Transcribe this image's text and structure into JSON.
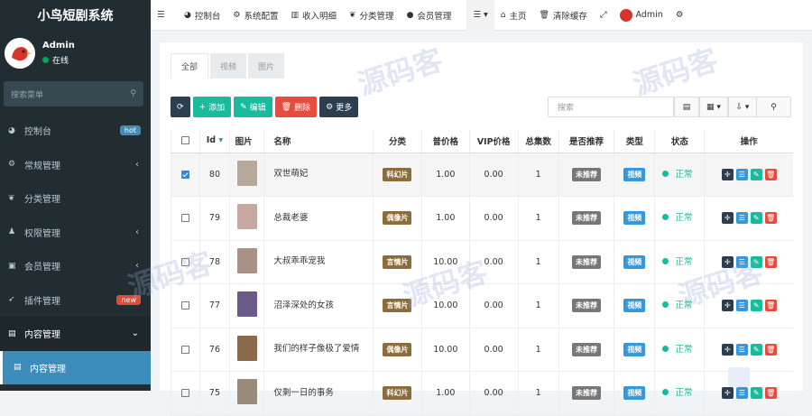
{
  "app": {
    "title": "小鸟短剧系统"
  },
  "user": {
    "name": "Admin",
    "status": "在线"
  },
  "sidebar": {
    "search_placeholder": "搜索菜单",
    "items": [
      {
        "label": "控制台",
        "badge": "hot",
        "badge_color": "#3c8dbc"
      },
      {
        "label": "常规管理",
        "arrow": "‹"
      },
      {
        "label": "分类管理"
      },
      {
        "label": "权限管理",
        "arrow": "‹"
      },
      {
        "label": "会员管理",
        "arrow": "‹"
      },
      {
        "label": "插件管理",
        "badge": "new",
        "badge_color": "#dd4b39"
      },
      {
        "label": "内容管理",
        "arrow": "⌄"
      },
      {
        "label": "内容管理"
      }
    ]
  },
  "topbar": {
    "items": [
      "控制台",
      "系统配置",
      "收入明细",
      "分类管理",
      "会员管理"
    ],
    "home": "主页",
    "clear_cache": "清除缓存",
    "admin": "Admin"
  },
  "tabs": [
    "全部",
    "视频",
    "图片"
  ],
  "toolbar": {
    "add": "添加",
    "edit": "编辑",
    "delete": "删除",
    "more": "更多",
    "search_placeholder": "搜索"
  },
  "table": {
    "headers": [
      "Id",
      "图片",
      "名称",
      "分类",
      "普价格",
      "VIP价格",
      "总集数",
      "是否推荐",
      "类型",
      "状态",
      "操作"
    ],
    "rows": [
      {
        "id": "80",
        "name": "双世萌妃",
        "category": "科幻片",
        "price": "1.00",
        "vip": "0.00",
        "episodes": "1",
        "recommend": "未推荐",
        "type": "视频",
        "status": "正常",
        "selected": true,
        "thumb": "#b9a99a"
      },
      {
        "id": "79",
        "name": "总裁老婆",
        "category": "偶像片",
        "price": "1.00",
        "vip": "0.00",
        "episodes": "1",
        "recommend": "未推荐",
        "type": "视频",
        "status": "正常",
        "selected": false,
        "thumb": "#c7a8a0"
      },
      {
        "id": "78",
        "name": "大叔乖乖宠我",
        "category": "言情片",
        "price": "10.00",
        "vip": "0.00",
        "episodes": "1",
        "recommend": "未推荐",
        "type": "视频",
        "status": "正常",
        "selected": false,
        "thumb": "#a99284"
      },
      {
        "id": "77",
        "name": "沼泽深处的女孩",
        "category": "言情片",
        "price": "10.00",
        "vip": "0.00",
        "episodes": "1",
        "recommend": "未推荐",
        "type": "视频",
        "status": "正常",
        "selected": false,
        "thumb": "#6a5a8a"
      },
      {
        "id": "76",
        "name": "我们的样子像极了爱情",
        "category": "偶像片",
        "price": "10.00",
        "vip": "0.00",
        "episodes": "1",
        "recommend": "未推荐",
        "type": "视频",
        "status": "正常",
        "selected": false,
        "thumb": "#8a6a4a"
      },
      {
        "id": "75",
        "name": "仅剩一日的事务",
        "category": "科幻片",
        "price": "1.00",
        "vip": "0.00",
        "episodes": "1",
        "recommend": "未推荐",
        "type": "视频",
        "status": "正常",
        "selected": false,
        "thumb": "#9a8a7a"
      }
    ]
  },
  "colors": {
    "category": "#8a6d3b",
    "recommend": "#777777",
    "type": "#3498db",
    "status": "#18bc9c"
  }
}
